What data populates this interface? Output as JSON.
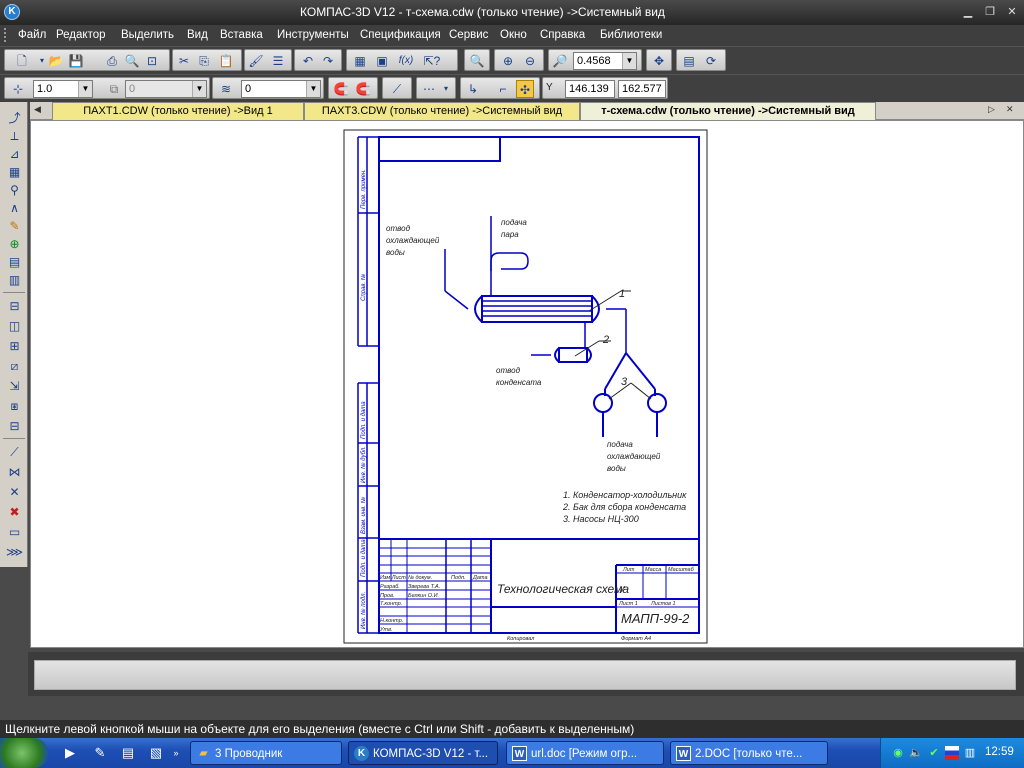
{
  "window": {
    "title": "КОМПАС-3D V12 - т-схема.cdw (только чтение) ->Системный вид",
    "app_icon": "K",
    "controls": [
      "minimize-icon",
      "restore-icon",
      "close-icon"
    ]
  },
  "menu": {
    "items": [
      "Файл",
      "Редактор",
      "Выделить",
      "Вид",
      "Вставка",
      "Инструменты",
      "Спецификация",
      "Сервис",
      "Окно",
      "Справка",
      "Библиотеки"
    ]
  },
  "toolbar_standard": {
    "zoom_value": "0.4568"
  },
  "toolbar_properties": {
    "line_width": "1.0",
    "layer_value": "0",
    "style_value": "0",
    "coord_x": "146.139",
    "coord_y": "162.577",
    "coord_y_label": "Y"
  },
  "tabs": [
    {
      "label": "ПАХТ1.CDW (только чтение) ->Вид 1",
      "active": false
    },
    {
      "label": "ПАХТ3.CDW (только чтение) ->Системный вид",
      "active": false
    },
    {
      "label": "т-схема.cdw (только чтение) ->Системный вид",
      "active": true
    }
  ],
  "drawing": {
    "label_otvod_ohl": [
      "отвод",
      "охлаждающей",
      "воды"
    ],
    "label_podacha_para": [
      "подача",
      "пара"
    ],
    "label_otvod_kond": [
      "отвод",
      "конденсата"
    ],
    "label_podacha_ohl": [
      "подача",
      "охлаждающей",
      "воды"
    ],
    "pos1": "1",
    "pos2": "2",
    "pos3": "3",
    "legend": [
      "1. Конденсатор-холодильник",
      "2. Бак для сбора конденсата",
      "3. Насосы НЦ-300"
    ],
    "stamp_title": "Технологическая схема",
    "stamp_code": "МАПП-99-2",
    "stamp_lit": "Лит",
    "stamp_mass": "Масса",
    "stamp_scale": "Масштаб",
    "stamp_sheet": "Лист 1",
    "stamp_sheets": "Листов 1",
    "stamp_u": "у",
    "stamp_copy": "Копировал",
    "stamp_format": "Формат А4",
    "stamp_rows": [
      "Изм.Лист",
      "№ докум.",
      "Подп.",
      "Дата"
    ],
    "stamp_razrab": "Разраб.",
    "stamp_razrab_name": "Зверева Т.А.",
    "stamp_prov": "Пров.",
    "stamp_prov_name": "Белкин О.И.",
    "stamp_tkontr": "Т.контр.",
    "stamp_nkontr": "Н.контр.",
    "stamp_utv": "Утв.",
    "side_labels": [
      "Перв. примен.",
      "Справ. №",
      "Подп. и дата",
      "Инв. № дубл.",
      "Взам. инв. №",
      "Подп. и дата",
      "Инв. № подл."
    ]
  },
  "status_text": "Щелкните левой кнопкой мыши на объекте для его выделения (вместе с Ctrl или Shift - добавить к выделенным)",
  "taskbar": {
    "buttons": [
      {
        "label": "3 Проводник",
        "icon": "folder-icon"
      },
      {
        "label": "КОМПАС-3D V12 - т...",
        "icon": "kompas-icon"
      },
      {
        "label": "url.doc [Режим огр...",
        "icon": "word-icon"
      },
      {
        "label": "2.DOC [только чте...",
        "icon": "word-icon"
      }
    ],
    "clock": "12:59"
  },
  "colors": {
    "drawing_line": "#0000c8",
    "active_tab": "#eef0d8",
    "inactive_tab": "#f2e88a"
  }
}
